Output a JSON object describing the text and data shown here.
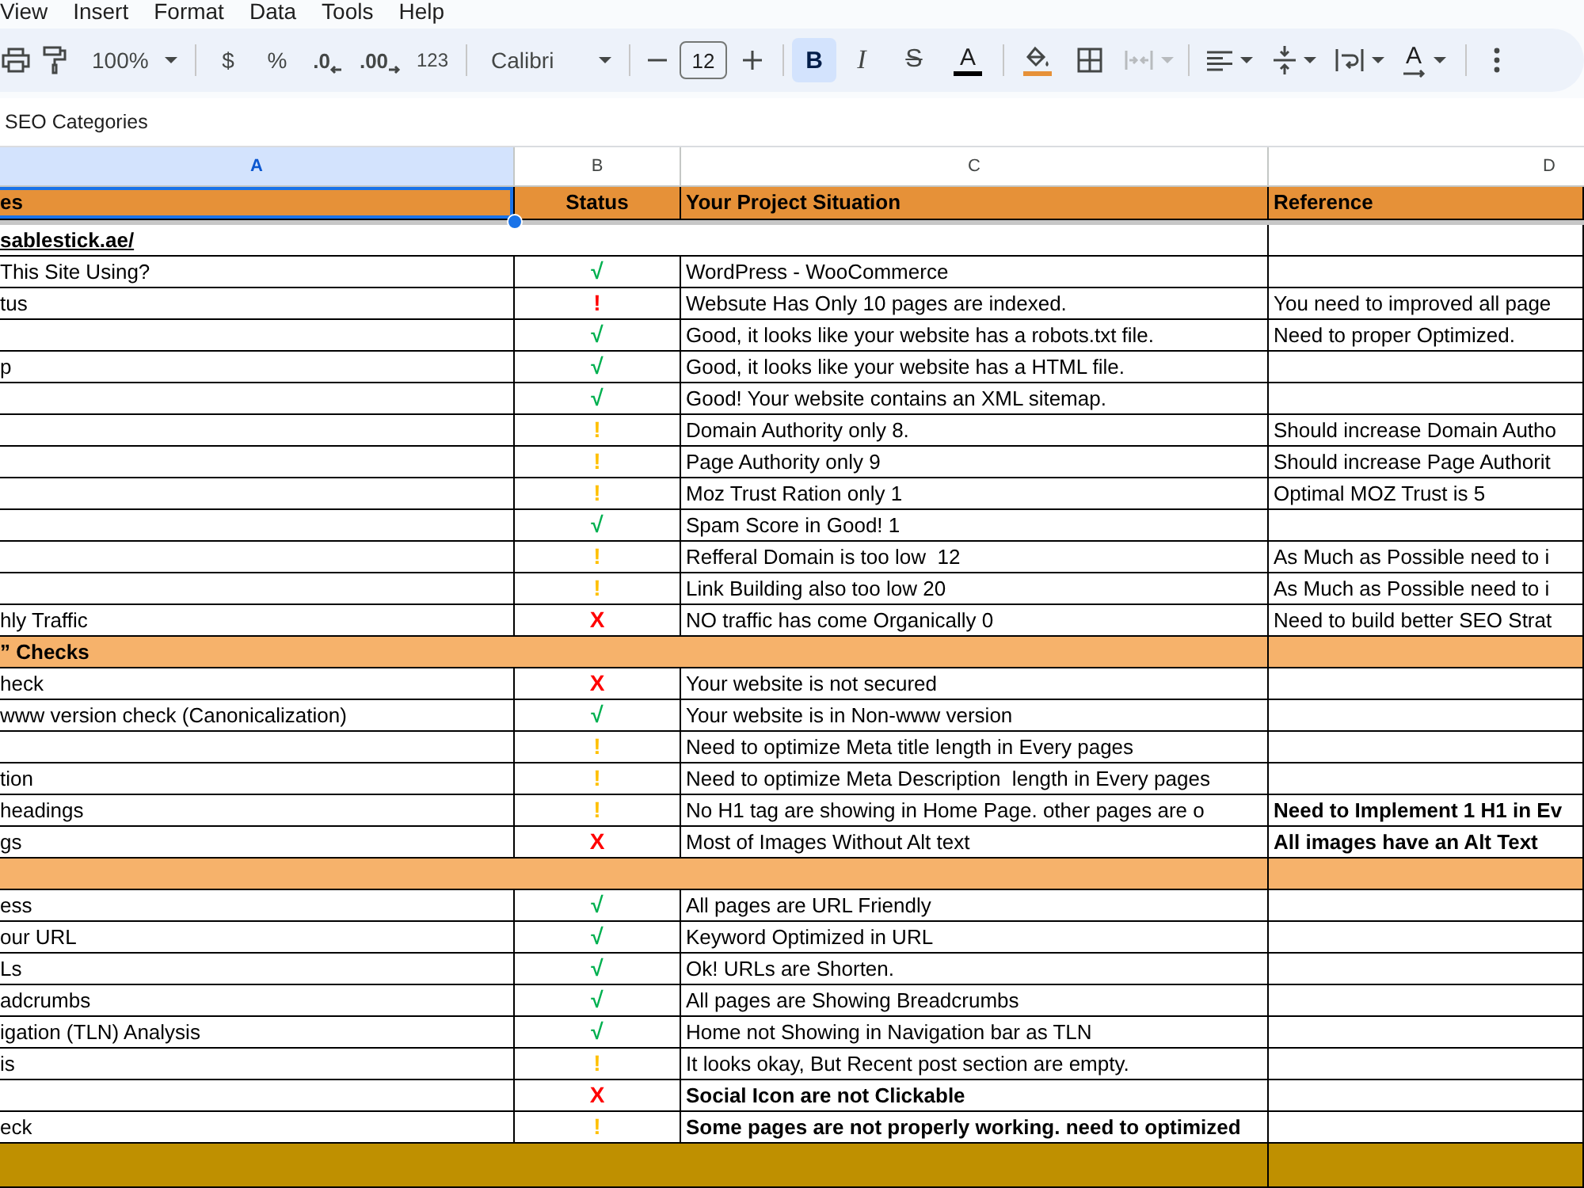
{
  "menu_bar": [
    "View",
    "Insert",
    "Format",
    "Data",
    "Tools",
    "Help"
  ],
  "toolbar": {
    "zoom": "100%",
    "currency": "$",
    "percent": "%",
    "decrease_decimal": ".0",
    "increase_decimal": ".00",
    "number_format": "123",
    "font": "Calibri",
    "font_size": "12",
    "bold": {
      "label": "B",
      "selected": true
    },
    "italic": {
      "label": "I",
      "selected": false
    },
    "strikethrough": {
      "label": "S",
      "selected": false
    },
    "text_color": {
      "label": "A",
      "color": "#000000"
    },
    "fill_color": {
      "color": "#e69138"
    },
    "merge": {
      "disabled": true
    },
    "text_rotation": {
      "label": "A"
    }
  },
  "formula_bar": {
    "value": "SEO Categories"
  },
  "column_headers": [
    {
      "label": "A",
      "selected": true
    },
    {
      "label": "B",
      "selected": false
    },
    {
      "label": "C",
      "selected": false
    },
    {
      "label": "D",
      "selected": false
    }
  ],
  "header_row": [
    {
      "text": "es",
      "selected": true
    },
    {
      "text": "Status",
      "selected": false
    },
    {
      "text": "Your Project Situation",
      "selected": false
    },
    {
      "text": "Reference",
      "selected": false
    }
  ],
  "rows": [
    {
      "kind": "link",
      "text": "sablestick.ae/"
    },
    {
      "kind": "data",
      "category": "This Site Using?",
      "status": {
        "symbol": "√",
        "color": "#00b050"
      },
      "situation": "WordPress - WooCommerce",
      "situation_bold": false
    },
    {
      "kind": "data",
      "category": "tus",
      "status": {
        "symbol": "!",
        "color": "#ff0000"
      },
      "situation": "Websute Has Only 10 pages are indexed.",
      "situation_bold": false,
      "reference": "You need to improved all page",
      "reference_bold": false
    },
    {
      "kind": "data",
      "status": {
        "symbol": "√",
        "color": "#00b050"
      },
      "situation": "Good, it looks like your website has a robots.txt file.",
      "situation_bold": false,
      "reference": "Need to proper Optimized.",
      "reference_bold": false
    },
    {
      "kind": "data",
      "category": "p",
      "status": {
        "symbol": "√",
        "color": "#00b050"
      },
      "situation": "Good, it looks like your website has a HTML file.",
      "situation_bold": false
    },
    {
      "kind": "data",
      "status": {
        "symbol": "√",
        "color": "#00b050"
      },
      "situation": "Good! Your website contains an XML sitemap.",
      "situation_bold": false
    },
    {
      "kind": "data",
      "status": {
        "symbol": "!",
        "color": "#ffc000"
      },
      "situation": "Domain Authority only 8.",
      "situation_bold": false,
      "reference": "Should increase Domain Autho",
      "reference_bold": false
    },
    {
      "kind": "data",
      "status": {
        "symbol": "!",
        "color": "#ffc000"
      },
      "situation": "Page Authority only 9",
      "situation_bold": false,
      "reference": "Should increase Page Authorit",
      "reference_bold": false
    },
    {
      "kind": "data",
      "status": {
        "symbol": "!",
        "color": "#ffc000"
      },
      "situation": "Moz Trust Ration only 1",
      "situation_bold": false,
      "reference": "Optimal MOZ Trust is 5",
      "reference_bold": false
    },
    {
      "kind": "data",
      "status": {
        "symbol": "√",
        "color": "#00b050"
      },
      "situation": "Spam Score in Good! 1",
      "situation_bold": false
    },
    {
      "kind": "data",
      "status": {
        "symbol": "!",
        "color": "#ffc000"
      },
      "situation": "Refferal Domain is too low  12",
      "situation_bold": false,
      "reference": "As Much as Possible need to i",
      "reference_bold": false
    },
    {
      "kind": "data",
      "status": {
        "symbol": "!",
        "color": "#ffc000"
      },
      "situation": "Link Building also too low 20",
      "situation_bold": false,
      "reference": "As Much as Possible need to i",
      "reference_bold": false
    },
    {
      "kind": "data",
      "category": "hly Traffic",
      "status": {
        "symbol": "X",
        "color": "#ff0000"
      },
      "situation": "NO traffic has come Organically 0",
      "situation_bold": false,
      "reference": "Need to build better SEO Strat",
      "reference_bold": false
    },
    {
      "kind": "section",
      "title": "” Checks",
      "color": "#f6b26b"
    },
    {
      "kind": "data",
      "category": "heck",
      "status": {
        "symbol": "X",
        "color": "#ff0000"
      },
      "situation": "Your website is not secured",
      "situation_bold": false
    },
    {
      "kind": "data",
      "category": "www version check (Canonicalization)",
      "status": {
        "symbol": "√",
        "color": "#00b050"
      },
      "situation": "Your website is in Non-www version",
      "situation_bold": false
    },
    {
      "kind": "data",
      "status": {
        "symbol": "!",
        "color": "#ffc000"
      },
      "situation": "Need to optimize Meta title length in Every pages",
      "situation_bold": false
    },
    {
      "kind": "data",
      "category": "tion",
      "status": {
        "symbol": "!",
        "color": "#ffc000"
      },
      "situation": "Need to optimize Meta Description  length in Every pages",
      "situation_bold": false
    },
    {
      "kind": "data",
      "category": "headings",
      "status": {
        "symbol": "!",
        "color": "#ffc000"
      },
      "situation": "No H1 tag are showing in Home Page. other pages are o",
      "situation_bold": false,
      "reference": "Need to Implement 1 H1 in Ev",
      "reference_bold": true
    },
    {
      "kind": "data",
      "category": "gs",
      "status": {
        "symbol": "X",
        "color": "#ff0000"
      },
      "situation": "Most of Images Without Alt text",
      "situation_bold": false,
      "reference": "All images have an Alt Text",
      "reference_bold": true
    },
    {
      "kind": "section",
      "color": "#f6b26b"
    },
    {
      "kind": "data",
      "category": "ess",
      "status": {
        "symbol": "√",
        "color": "#00b050"
      },
      "situation": "All pages are URL Friendly",
      "situation_bold": false
    },
    {
      "kind": "data",
      "category": "our URL",
      "status": {
        "symbol": "√",
        "color": "#00b050"
      },
      "situation": "Keyword Optimized in URL",
      "situation_bold": false
    },
    {
      "kind": "data",
      "category": "Ls",
      "status": {
        "symbol": "√",
        "color": "#00b050"
      },
      "situation": "Ok! URLs are Shorten.",
      "situation_bold": false
    },
    {
      "kind": "data",
      "category": "adcrumbs",
      "status": {
        "symbol": "√",
        "color": "#00b050"
      },
      "situation": "All pages are Showing Breadcrumbs",
      "situation_bold": false
    },
    {
      "kind": "data",
      "category": "igation (TLN) Analysis",
      "status": {
        "symbol": "√",
        "color": "#00b050"
      },
      "situation": "Home not Showing in Navigation bar as TLN",
      "situation_bold": false
    },
    {
      "kind": "data",
      "category": "is",
      "status": {
        "symbol": "!",
        "color": "#ffc000"
      },
      "situation": "It looks okay, But Recent post section are empty.",
      "situation_bold": false
    },
    {
      "kind": "data",
      "status": {
        "symbol": "X",
        "color": "#ff0000"
      },
      "situation": "Social Icon are not Clickable",
      "situation_bold": true
    },
    {
      "kind": "data",
      "category": "eck",
      "status": {
        "symbol": "!",
        "color": "#ffc000"
      },
      "situation": "Some pages are not properly working. need to optimized",
      "situation_bold": true
    },
    {
      "kind": "section",
      "color": "#bf9000"
    }
  ]
}
